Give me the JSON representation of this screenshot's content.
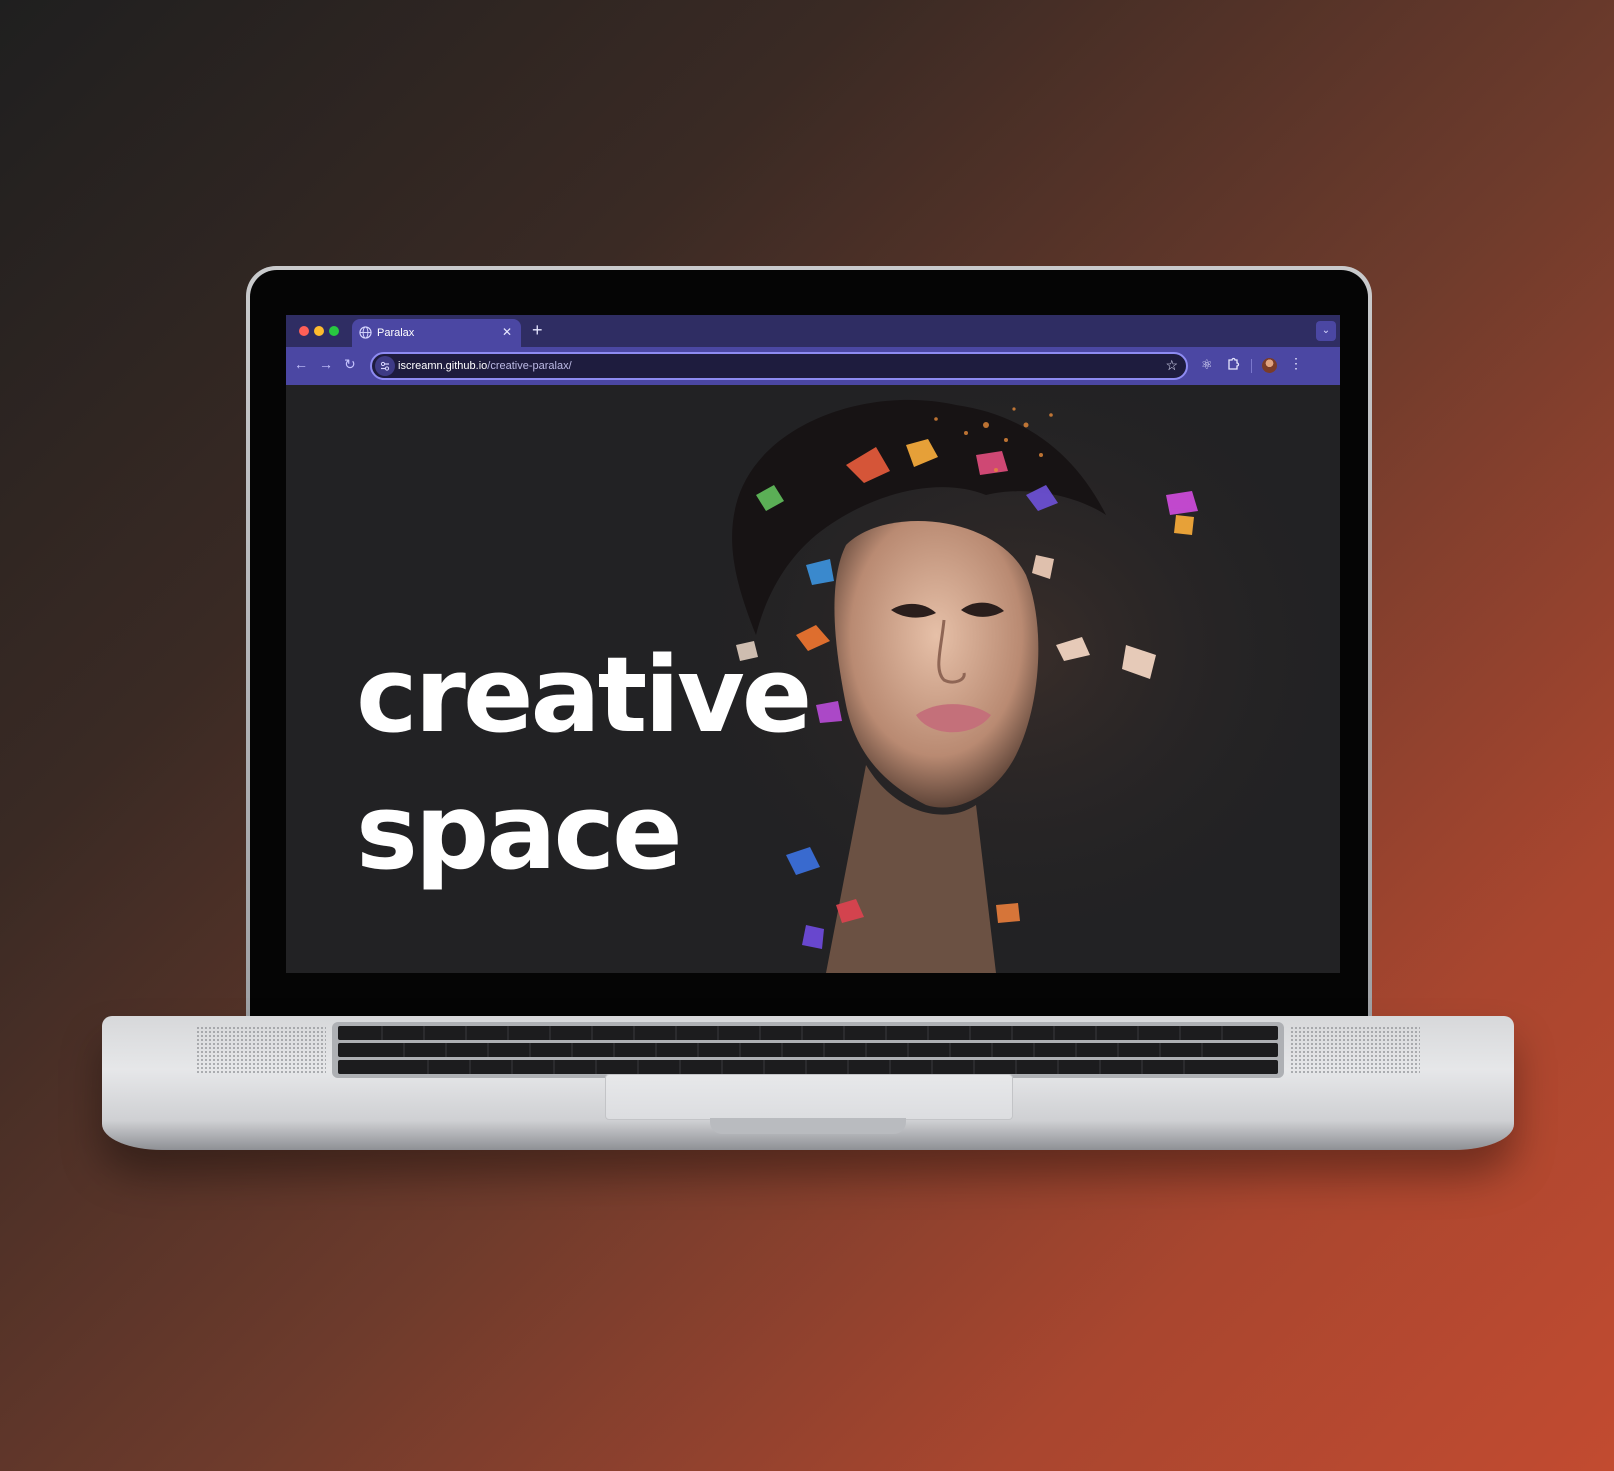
{
  "browser": {
    "tab": {
      "title": "Paralax"
    },
    "address_bar": {
      "domain": "iscreamn.github.io",
      "path": "/creative-paralax/"
    }
  },
  "page": {
    "headline_line1": "creative",
    "headline_line2": "space"
  },
  "colors": {
    "tab_bar": "#2f2d63",
    "toolbar": "#4b47a3",
    "page_background": "#222224",
    "headline": "#ffffff"
  },
  "icons": [
    "globe-icon",
    "close-icon",
    "plus-icon",
    "chevron-down-icon",
    "back-arrow-icon",
    "forward-arrow-icon",
    "reload-icon",
    "site-info-icon",
    "star-icon",
    "react-icon",
    "puzzle-icon",
    "more-vertical-icon"
  ]
}
